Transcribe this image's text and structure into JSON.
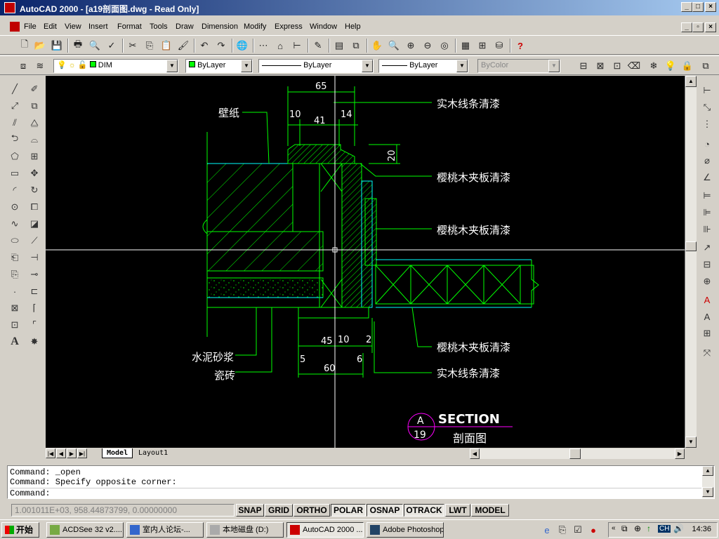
{
  "window": {
    "title": "AutoCAD 2000 - [a19剖面图.dwg - Read Only]",
    "min": "_",
    "max": "□",
    "close": "×"
  },
  "menu": [
    "File",
    "Edit",
    "View",
    "Insert",
    "Format",
    "Tools",
    "Draw",
    "Dimension",
    "Modify",
    "Express",
    "Window",
    "Help"
  ],
  "standard_toolbar": [
    "new-icon",
    "open-icon",
    "save-icon",
    "print-icon",
    "print-preview-icon",
    "spelling-icon",
    "cut-icon",
    "copy-icon",
    "paste-icon",
    "match-properties-icon",
    "undo-icon",
    "redo-icon",
    "hyperlink-icon",
    "tracking-icon",
    "osnap-icon",
    "ucs-icon",
    "pan-icon",
    "zoom-icon",
    "zoom-window-icon",
    "zoom-previous-icon",
    "aerial-view-icon",
    "properties-icon",
    "design-center-icon",
    "dbconnect-icon",
    "help-icon"
  ],
  "object_props": {
    "layer": "DIM",
    "color": "ByLayer",
    "linetype": "ByLayer",
    "lineweight": "ByLayer",
    "plotstyle": "ByColor"
  },
  "drawing": {
    "labels": {
      "wallpaper": "壁纸",
      "wood_strip_top": "实木线条清漆",
      "cherry_ply_1": "樱桃木夹板清漆",
      "cherry_ply_2": "樱桃木夹板清漆",
      "cherry_ply_3": "樱桃木夹板清漆",
      "wood_strip_bottom": "实木线条清漆",
      "cement_mortar": "水泥砂浆",
      "tile": "瓷砖"
    },
    "dims": {
      "d65": "65",
      "d10a": "10",
      "d14": "14",
      "d41": "41",
      "d20": "20",
      "d45": "45",
      "d10b": "10",
      "d2": "2",
      "d5": "5",
      "d6": "6",
      "d60": "60"
    },
    "section": {
      "letter": "A",
      "number": "19",
      "title": "SECTION",
      "subtitle": "剖面图"
    }
  },
  "tabs": [
    "Model",
    "Layout1"
  ],
  "command": {
    "line1": "Command: _open",
    "line2": "Command: Specify opposite corner:",
    "prompt": "Command:"
  },
  "status": {
    "coords": "1.001011E+03, 958.44873799, 0.00000000",
    "buttons": [
      "SNAP",
      "GRID",
      "ORTHO",
      "POLAR",
      "OSNAP",
      "OTRACK",
      "LWT",
      "MODEL"
    ]
  },
  "taskbar": {
    "start": "开始",
    "tasks": [
      "ACDSee 32 v2....",
      "室内人论坛-...",
      "本地磁盘 (D:)",
      "AutoCAD 2000 ...",
      "Adobe Photoshop"
    ],
    "tray_lang": "CH",
    "clock": "14:36"
  },
  "colors": {
    "accent": "#0a246a",
    "green": "#00ff00",
    "cyan": "#00ffff",
    "magenta": "#ff00ff",
    "white": "#ffffff"
  }
}
